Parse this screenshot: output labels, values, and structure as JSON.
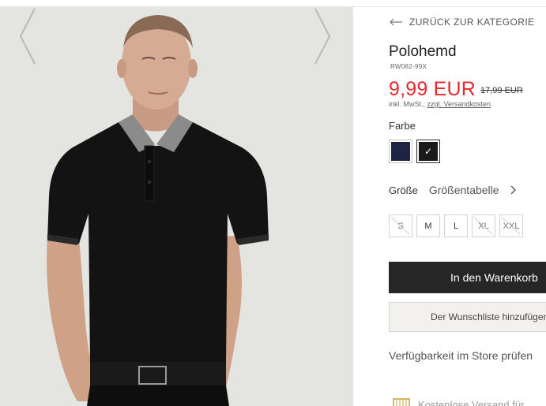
{
  "product": {
    "back_label": "ZURÜCK ZUR KATEGORIE",
    "title": "Polohemd",
    "sku": "RW082-99X",
    "price": "9,99 EUR",
    "old_price": "17,99 EUR",
    "tax_prefix": "inkl. MwSt., ",
    "tax_link": "zzgl. Versandkosten",
    "color_label": "Farbe",
    "colors": [
      {
        "name": "navy",
        "hex": "#1f2442",
        "selected": false
      },
      {
        "name": "black",
        "hex": "#1a1a1a",
        "selected": true
      }
    ],
    "size_label": "Größe",
    "size_chart": "Größentabelle",
    "sizes": [
      {
        "label": "S",
        "available": false
      },
      {
        "label": "M",
        "available": true
      },
      {
        "label": "L",
        "available": true
      },
      {
        "label": "XL",
        "available": false
      },
      {
        "label": "XXL",
        "available": false
      }
    ],
    "add_to_cart": "In den Warenkorb",
    "wishlist": "Der Wunschliste hinzufügen",
    "store_availability": "Verfügbarkeit im Store prüfen",
    "shipping_note": "Kostenlose Versand für"
  },
  "colors": {
    "accent_red": "#e4292f",
    "button_dark": "#262626",
    "image_bg": "#e3e3e0"
  }
}
